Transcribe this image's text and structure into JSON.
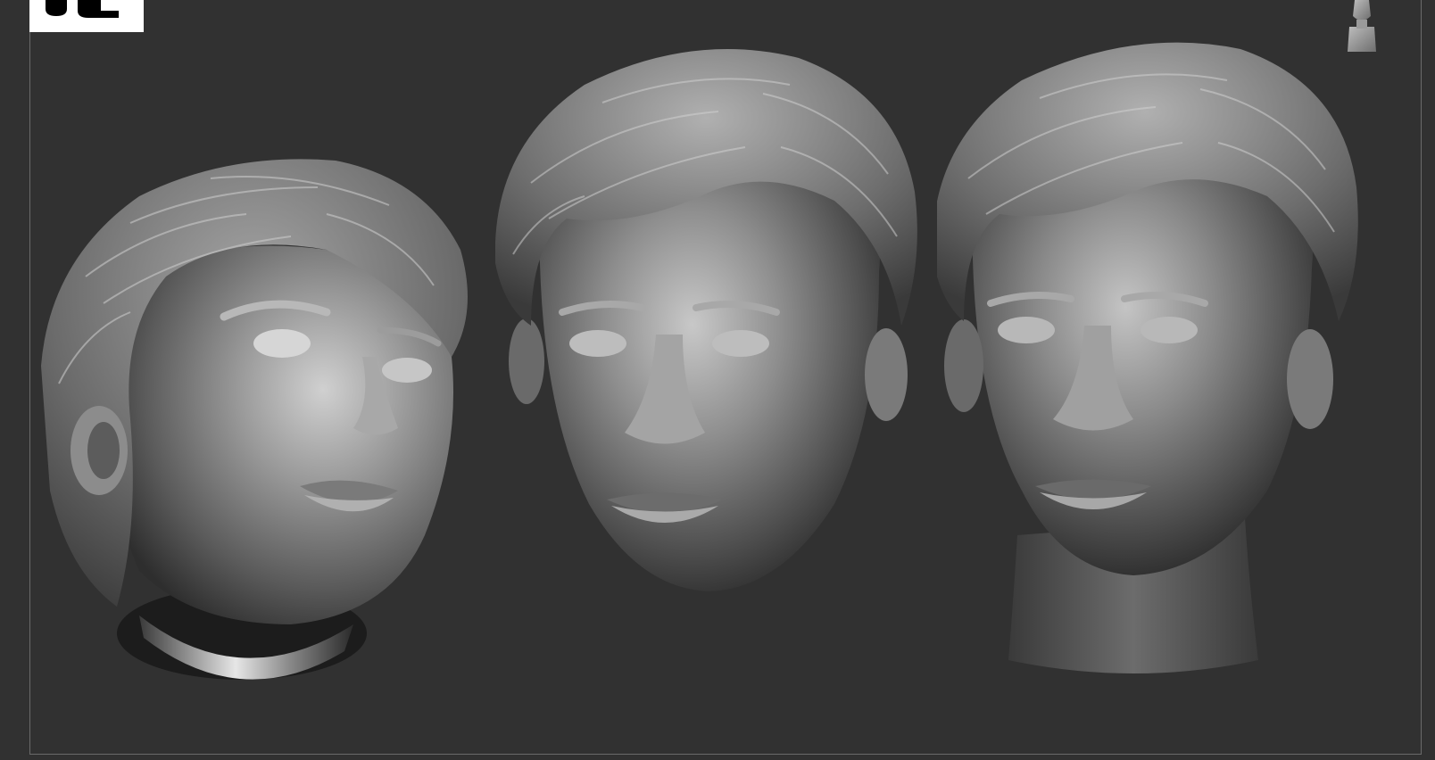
{
  "viewport": {
    "background": "#313131",
    "frame_color": "#6a6a6a"
  },
  "overlay": {
    "logo_icon": "logo-badge-icon",
    "navigation_icon": "head-gizmo-icon"
  },
  "sculpts": [
    {
      "icon": "head-three-quarter-sculpt"
    },
    {
      "icon": "face-mask-front-sculpt"
    },
    {
      "icon": "head-with-neck-front-sculpt"
    }
  ],
  "material": {
    "base_color": "#8a8a8a",
    "highlight_color": "#d8d8d8",
    "shadow_color": "#2a2a2a"
  }
}
